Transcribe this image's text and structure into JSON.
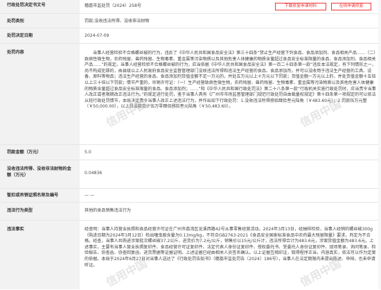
{
  "decision_no": {
    "label": "行政处罚决定书文号",
    "value": "穗荔市监处罚（2024）258号"
  },
  "buttons": {
    "download": "下载修复申请材料",
    "apply": "在线申请修复"
  },
  "category": {
    "label": "处罚类别",
    "value": "罚款;没收违法所得、没收非法财物"
  },
  "decision_date": {
    "label": "处罚决定日期",
    "value": "2024-07-09"
  },
  "content": {
    "label": "处罚内容",
    "text": "当事人经营检验不合格螺丝椒的行为，违反了《中华人民共和国食品安全法》第三十四条“禁止生产经营下列食品、食品添加剂、食品相关产品……（二）致病性微生物，农药残留、兽药残留、生物毒素、重金属等污染物质以及其他危害人体健康的物质含量超过食品安全标准限量的食品、食品添加剂、食品相关产品……”的规定。当事人经营检验不合格螺丝椒的行为，应当依据《中华人民共和国食品安全法》第一百二十四条第一款“违反本法规定，有下列情形之一，尚不构成犯罪的，由县级以上人民政府食品安全监督管理部门没收违法所得和违法生产经营的食品、食品添加剂，并可以没收用于违法生产经营的工具、设备、原料等物品；违法生产经营的食品、食品添加剂货值金额不足一万元的，并处五万元以上十万元以下罚款；货值金额一万元以上的，并处货值金额十五倍以上三十倍以下罚款；情节严重的，吊销许可证：（一）生产经营致病性微生物，农药残留、兽药残留、生物毒素、重金属等污染物质以及其他危害人体健康的物质含量超过食品安全标准限量的食品、食品添加剂；……”和《中华人民共和国行政处罚法》第二十八条第一款“行政机关实施行政处罚时，应当责令当事人改正或者限期改正违法行为。”的规定进行处罚，鉴于当事人具有《广州市市场监督管理部门规范行政处罚自由裁量权规定》第十四条第一项规定的可以依法从轻行政处罚情节，本局决定责令当事人改正上述违法行为，并作出如下行政处罚：1.没收违法所得捌佰肆拾叁元陆角（￥483.60元）；2.罚款伍万元整（￥50,000.00），以上罚没款合计伍万零肆佰捌拾叁元陆角（￥50,483.60）。"
  },
  "fine": {
    "label": "罚款金额（万元）",
    "value": "5.0"
  },
  "confiscation": {
    "label": "没收违法所得、没收非法财物的金额（万元）",
    "value": "0.04836"
  },
  "license": {
    "label": "暂扣或吊销证照名称及编号",
    "value": "— —"
  },
  "act": {
    "label": "违法行为类型",
    "value": "其他的食品销售违法行为"
  },
  "facts": {
    "label": "违法事实",
    "text": "经查明：当事人持营业执照和食品经营许可证在广州市荔湾区龙溪西路42号从事零售经营活动。2024年3月13日，经抽样检验，当事人经销的螺丝椒300g（购进日期为2024年3月12日）检出噻虫胺含量为0.13mg/kg，不符合GB2763-2021《食品安全国家标准食品中农药最大残留限量》要求，判定为不合格。经查，当事人共购进涉案批次螺丝椒37.2公斤，进货价为7.2元/公斤，销售价以15元/公斤计，违法所得合计为483.6元，涉案货值金额为483.6元。上述事实，主要有当事人营业执照复印件、食品经营许可证复印件、法定代表人身份证复印件、授权委托书、受委托人身份证复印件、现场笔录、询问笔录、检验报告、协查函、协查回复函、进货票据等证据证明。上述证据已经由相关人员签名确认。以上证据互相印证，取得程序正当，内容真实，依法可以作为定案的依据。本局于2024年6月27日对当事人送达了《行政处罚告知书》（穗荔市监处罚告〔2024〕186号），当事人在法定期限内未提出陈述、申辩，也未申请听证。"
  }
}
